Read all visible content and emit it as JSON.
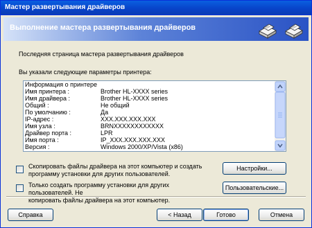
{
  "window": {
    "title": "Мастер развертывания драйверов"
  },
  "banner": {
    "title": "Выполнение мастера развертывания драйверов"
  },
  "intro": {
    "last_page": "Последняя страница мастера развертывания драйверов",
    "params_label": "Вы указали следующие параметры принтера:"
  },
  "info": {
    "header": "Информация о принтере",
    "rows": [
      {
        "key": "Имя принтера :",
        "value": "Brother HL-XXXX series"
      },
      {
        "key": "Имя драйвера :",
        "value": "Brother HL-XXXX series"
      },
      {
        "key": "Общий :",
        "value": "Не общий"
      },
      {
        "key": "По умолчанию :",
        "value": "Да"
      },
      {
        "key": "IP-адрес :",
        "value": "XXX.XXX.XXX.XXX"
      },
      {
        "key": "Имя узла :",
        "value": "BRNXXXXXXXXXXXX"
      },
      {
        "key": "Драйвер порта :",
        "value": "LPR"
      },
      {
        "key": "Имя порта :",
        "value": "IP_XXX.XXX.XXX.XXX"
      },
      {
        "key": "Версия :",
        "value": "Windows 2000/XP/Vista (x86)"
      }
    ]
  },
  "options": {
    "copy_files": {
      "line1": "Скопировать файлы драйвера на этот компьютер и создать",
      "line2": "программу установки для других пользователей."
    },
    "only_create": {
      "line1": "Только создать программу установки для других пользователей. Не",
      "line2": "копировать файлы драйвера на этот компьютер."
    }
  },
  "buttons": {
    "settings": "Настройки...",
    "custom": "Пользовательские...",
    "help": "Справка",
    "back": "< Назад",
    "finish": "Готово",
    "cancel": "Отмена"
  }
}
